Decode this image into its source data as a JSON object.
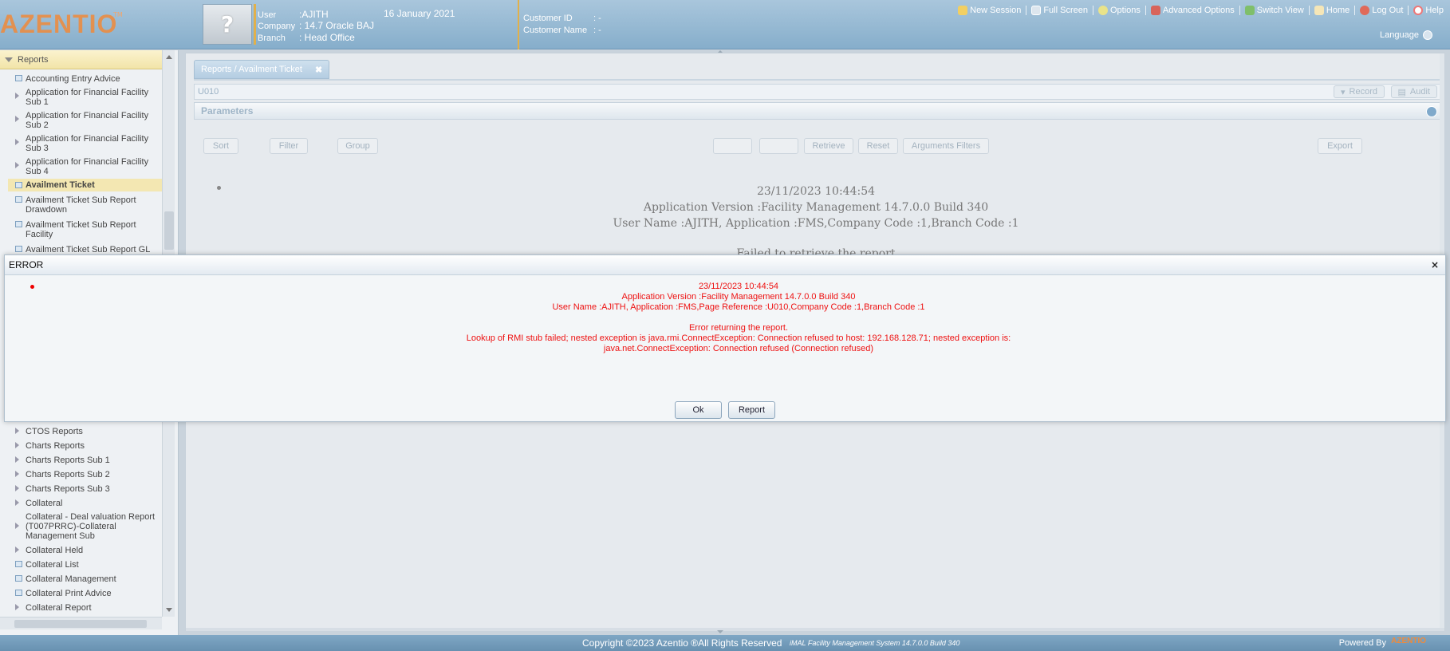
{
  "header": {
    "logo": "AZENTIO",
    "logo_mark": "TM",
    "user_label": "User",
    "user_value": ":AJITH",
    "company_label": "Company",
    "company_value": ": 14.7 Oracle BAJ",
    "branch_label": "Branch",
    "branch_value": ": Head Office",
    "date": "16 January 2021",
    "customer_id_label": "Customer ID",
    "customer_id_value": ":   -",
    "customer_name_label": "Customer Name",
    "customer_name_value": ": -",
    "nav": {
      "new_session": "New Session",
      "full_screen": "Full Screen",
      "options": "Options",
      "advanced_options": "Advanced Options",
      "switch_view": "Switch View",
      "home": "Home",
      "log_out": "Log Out",
      "help": "Help"
    },
    "language": "Language"
  },
  "sidebar": {
    "section": "Reports",
    "items_top": [
      {
        "label": "Accounting Entry Advice",
        "icon": "report-doc-icon"
      },
      {
        "label": "Application for Financial Facility Sub 1",
        "icon": "expand-arrow-icon"
      },
      {
        "label": "Application for Financial Facility Sub 2",
        "icon": "expand-arrow-icon"
      },
      {
        "label": "Application for Financial Facility Sub 3",
        "icon": "expand-arrow-icon"
      },
      {
        "label": "Application for Financial Facility Sub 4",
        "icon": "expand-arrow-icon"
      },
      {
        "label": "Availment Ticket",
        "icon": "report-doc-icon",
        "selected": true
      },
      {
        "label": "Availment Ticket Sub Report Drawdown",
        "icon": "report-doc-icon"
      },
      {
        "label": "Availment Ticket Sub Report Facility",
        "icon": "report-doc-icon"
      },
      {
        "label": "Availment Ticket Sub Report GL",
        "icon": "report-doc-icon"
      }
    ],
    "items_bottom": [
      {
        "label": "CTOS Reports",
        "icon": "expand-arrow-icon"
      },
      {
        "label": "Charts Reports",
        "icon": "expand-arrow-icon"
      },
      {
        "label": "Charts Reports Sub 1",
        "icon": "expand-arrow-icon"
      },
      {
        "label": "Charts Reports Sub 2",
        "icon": "expand-arrow-icon"
      },
      {
        "label": "Charts Reports Sub 3",
        "icon": "expand-arrow-icon"
      },
      {
        "label": "Collateral",
        "icon": "expand-arrow-icon"
      },
      {
        "label": "Collateral - Deal valuation Report (T007PRRC)-Collateral Management Sub",
        "icon": "expand-arrow-icon"
      },
      {
        "label": "Collateral Held",
        "icon": "expand-arrow-icon"
      },
      {
        "label": "Collateral List",
        "icon": "report-doc-icon"
      },
      {
        "label": "Collateral Management",
        "icon": "report-doc-icon"
      },
      {
        "label": "Collateral Print Advice",
        "icon": "report-doc-icon"
      },
      {
        "label": "Collateral Report",
        "icon": "expand-arrow-icon"
      }
    ]
  },
  "main": {
    "tab": "Reports / Availment Ticket",
    "tab_close": "✖",
    "screen_code": "U010",
    "record_label": "Record",
    "audit_label": "Audit",
    "parameters_label": "Parameters",
    "toolbar": {
      "sort": "Sort",
      "filter": "Filter",
      "group": "Group",
      "retrieve": "Retrieve",
      "reset": "Reset",
      "arguments_filters": "Arguments Filters",
      "export": "Export"
    },
    "report_message": {
      "timestamp": "23/11/2023 10:44:54",
      "version": "Application Version :Facility Management 14.7.0.0 Build 340",
      "user_info": "User Name :AJITH, Application :FMS,Company Code :1,Branch Code :1",
      "failed": "Failed to retrieve the report"
    }
  },
  "error_dialog": {
    "title": "ERROR",
    "close": "×",
    "timestamp": "23/11/2023 10:44:54",
    "version": "Application Version :Facility Management 14.7.0.0 Build 340",
    "user_info": "User Name :AJITH, Application :FMS,Page Reference :U010,Company Code :1,Branch Code :1",
    "error_heading": "Error returning the report.",
    "detail_1": "Lookup of RMI stub failed; nested exception is java.rmi.ConnectException: Connection refused to host: 192.168.128.71; nested exception is:",
    "detail_2": "java.net.ConnectException: Connection refused (Connection refused)",
    "ok_button": "Ok",
    "report_button": "Report"
  },
  "footer": {
    "copyright": "Copyright ©2023 Azentio ®All Rights Reserved",
    "system": "iMAL Facility Management System 14.7.0.0 Build 340",
    "powered_by": "Powered By",
    "powered_logo": "AZENTIO"
  },
  "colors": {
    "header_bg": "#86aecb",
    "accent_gold": "#e1b04b",
    "logo_orange": "#f08a3a",
    "error_red": "#ee1111",
    "selected_item_bg": "#f3e7b2"
  }
}
